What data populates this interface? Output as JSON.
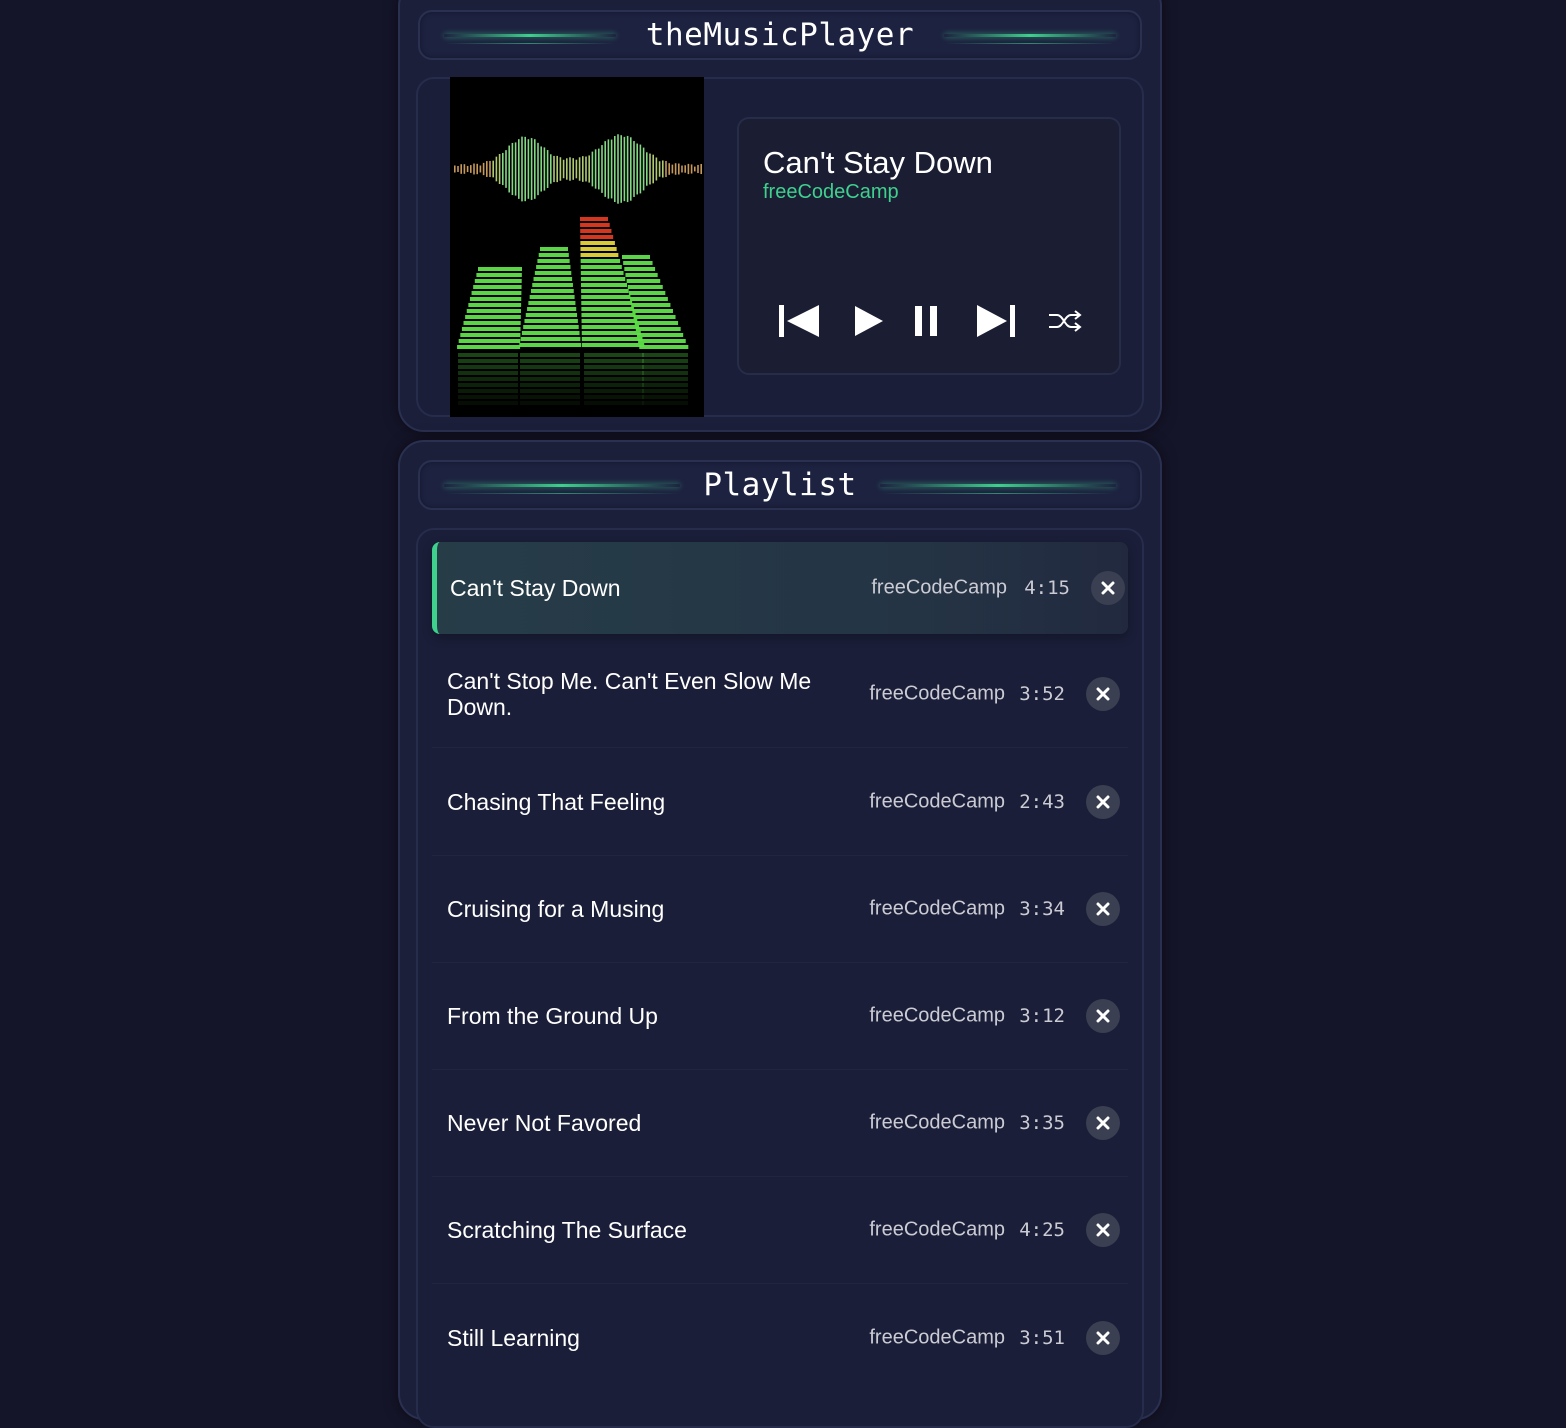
{
  "app": {
    "title": "theMusicPlayer"
  },
  "now_playing": {
    "title": "Can't Stay Down",
    "artist": "freeCodeCamp"
  },
  "controls": {
    "previous_icon": "skip-previous-icon",
    "play_icon": "play-icon",
    "pause_icon": "pause-icon",
    "next_icon": "skip-next-icon",
    "shuffle_icon": "shuffle-icon"
  },
  "playlist": {
    "title": "Playlist",
    "songs": [
      {
        "title": "Can't Stay Down",
        "artist": "freeCodeCamp",
        "duration": "4:15",
        "active": true
      },
      {
        "title": "Can't Stop Me. Can't Even Slow Me Down.",
        "artist": "freeCodeCamp",
        "duration": "3:52"
      },
      {
        "title": "Chasing That Feeling",
        "artist": "freeCodeCamp",
        "duration": "2:43"
      },
      {
        "title": "Cruising for a Musing",
        "artist": "freeCodeCamp",
        "duration": "3:34"
      },
      {
        "title": "From the Ground Up",
        "artist": "freeCodeCamp",
        "duration": "3:12"
      },
      {
        "title": "Never Not Favored",
        "artist": "freeCodeCamp",
        "duration": "3:35"
      },
      {
        "title": "Scratching The Surface",
        "artist": "freeCodeCamp",
        "duration": "4:25"
      },
      {
        "title": "Still Learning",
        "artist": "freeCodeCamp",
        "duration": "3:51"
      }
    ]
  },
  "colors": {
    "background": "#15152a",
    "panel": "#1b1f3a",
    "accent": "#3fd08e",
    "text": "#ffffff",
    "muted_text": "#cbcbd4"
  }
}
